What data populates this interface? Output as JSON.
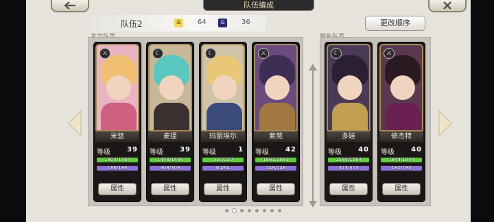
{
  "header": {
    "title": "队伍编成"
  },
  "team": {
    "name": "队伍2",
    "stat1_icon": "cost-icon",
    "stat1_value": "64",
    "stat2_icon": "power-icon",
    "stat2_value": "36",
    "reorder_label": "更改顺序"
  },
  "sections": {
    "main": "主力队员",
    "sub": "替补队员"
  },
  "labels": {
    "level": "等级",
    "attribute": "属性"
  },
  "colors": {
    "hp": "#5fcf3d",
    "sp": "#8f6fd8",
    "accent": "#a88d5c"
  },
  "main_members": [
    {
      "name": "米悠",
      "level": "39",
      "hp": "1804/1804",
      "sp": "186/186",
      "badge": "sword-icon",
      "hair": "#f0c070",
      "outfit": "#d06080",
      "bg": "#e8b4c0"
    },
    {
      "name": "麦提",
      "level": "39",
      "hp": "1448/1448",
      "sp": "308/308",
      "badge": "moon-icon",
      "hair": "#5ac8c0",
      "outfit": "#3a3030",
      "bg": "#c8b89a"
    },
    {
      "name": "玛丽埃尔",
      "level": "1",
      "hp": "330/330",
      "sp": "64/64",
      "badge": "moon-icon",
      "hair": "#e8c878",
      "outfit": "#3a4a7a",
      "bg": "#cfc3a8"
    },
    {
      "name": "紫苑",
      "level": "42",
      "hp": "1883/1883",
      "sp": "248/248",
      "badge": "sword-icon",
      "hair": "#3c2e55",
      "outfit": "#a07840",
      "bg": "#6b4a80"
    }
  ],
  "sub_members": [
    {
      "name": "多娃",
      "level": "40",
      "hp": "1584/1584",
      "sp": "313/313",
      "badge": "moon-icon",
      "hair": "#2a1f33",
      "outfit": "#c0a050",
      "bg": "#4a3a55"
    },
    {
      "name": "修杰特",
      "level": "40",
      "hp": "1844/1844",
      "sp": "180/180",
      "badge": "sword-icon",
      "hair": "#2a1a22",
      "outfit": "#6a2050",
      "bg": "#5a3850"
    }
  ],
  "pager": {
    "count": 8,
    "active": 1
  }
}
